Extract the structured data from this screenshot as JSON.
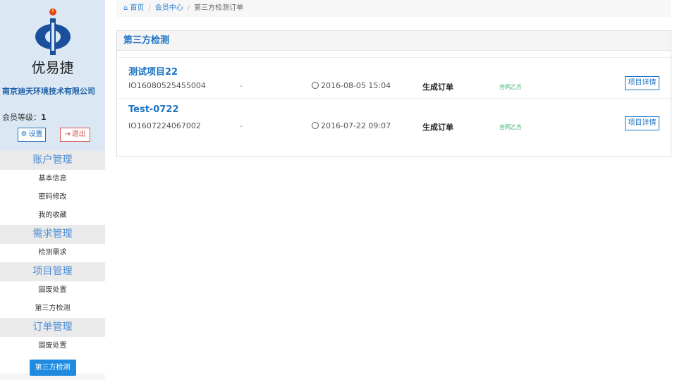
{
  "sidebar": {
    "brand": "优易捷",
    "company": "南京迪天环境技术有限公司",
    "level_label": "会员等级：",
    "level_value": "1",
    "settings_label": "设置",
    "logout_label": "退出",
    "groups": [
      {
        "title": "账户管理",
        "items": [
          "基本信息",
          "密码修改",
          "我的收藏"
        ]
      },
      {
        "title": "需求管理",
        "items": [
          "检测需求"
        ]
      },
      {
        "title": "项目管理",
        "items": [
          "固废处置",
          "第三方检测"
        ]
      },
      {
        "title": "订单管理",
        "items": [
          "固废处置",
          "第三方检测"
        ]
      }
    ],
    "active_item": "第三方检测"
  },
  "breadcrumb": {
    "home": "首页",
    "member": "会员中心",
    "current": "第三方检测订单"
  },
  "panel": {
    "title": "第三方检测",
    "orders": [
      {
        "name": "测试项目22",
        "code": "IO16080525455004",
        "dash": "-",
        "time": "2016-08-05 15:04",
        "status": "生成订单",
        "tag": "合同乙方",
        "button": "项目详情"
      },
      {
        "name": "Test-0722",
        "code": "IO1607224067002",
        "dash": "-",
        "time": "2016-07-22 09:07",
        "status": "生成订单",
        "tag": "合同乙方",
        "button": "项目详情"
      }
    ]
  },
  "colors": {
    "accent": "#1e73c4",
    "danger": "#d9534f",
    "success": "#27ae60"
  }
}
